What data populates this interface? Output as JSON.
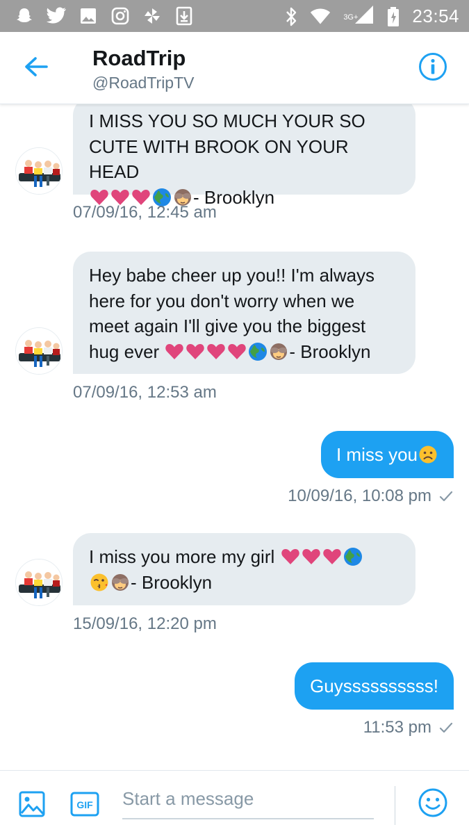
{
  "status_bar": {
    "network": "3G+",
    "time": "23:54",
    "left_icons": [
      "snapchat-icon",
      "twitter-icon",
      "gallery-icon",
      "instagram-icon",
      "pinwheel-icon",
      "download-icon"
    ],
    "right_icons": [
      "bluetooth-icon",
      "wifi-icon",
      "signal-icon",
      "battery-icon"
    ]
  },
  "header": {
    "title": "RoadTrip",
    "handle": "@RoadTripTV",
    "back_icon": "arrow-left-icon",
    "info_icon": "info-circle-icon"
  },
  "messages": [
    {
      "direction": "incoming",
      "lines": [
        "I MISS YOU SO MUCH YOUR SO",
        "CUTE WITH BROOK ON YOUR HEAD"
      ],
      "emoji_line": [
        "heart",
        "heart",
        "heart",
        "globe",
        "see-no-evil"
      ],
      "tail": "- Brooklyn",
      "timestamp": "07/09/16, 12:45 am"
    },
    {
      "direction": "incoming",
      "lines": [
        "Hey babe cheer up you!! I'm always",
        "here for you don't worry when we",
        "meet again I'll give you the biggest"
      ],
      "last_line_text": "hug ever",
      "emoji_line": [
        "heart",
        "heart",
        "heart",
        "heart",
        "globe",
        "see-no-evil"
      ],
      "tail": "- Brooklyn",
      "timestamp": "07/09/16, 12:53 am"
    },
    {
      "direction": "outgoing",
      "text": "I miss you",
      "emoji": "frowning",
      "timestamp": "10/09/16, 10:08 pm"
    },
    {
      "direction": "incoming",
      "first_line_text": "I miss you more my girl",
      "first_line_emoji": [
        "heart",
        "heart",
        "heart",
        "globe"
      ],
      "second_line_emoji": [
        "kissing-wink",
        "see-no-evil"
      ],
      "tail": "- Brooklyn",
      "timestamp": "15/09/16, 12:20 pm"
    },
    {
      "direction": "outgoing",
      "text": "Guyssssssssss!",
      "timestamp": "11:53 pm"
    }
  ],
  "composer": {
    "placeholder": "Start a message",
    "gif_label": "GIF",
    "media_icon": "image-icon",
    "emoji_icon": "smiley-icon"
  },
  "colors": {
    "accent": "#1da1f2",
    "incoming_bubble": "#e6ecf0",
    "secondary_text": "#657786",
    "status_bar": "#9e9e9e",
    "heart": "#e0457b"
  }
}
